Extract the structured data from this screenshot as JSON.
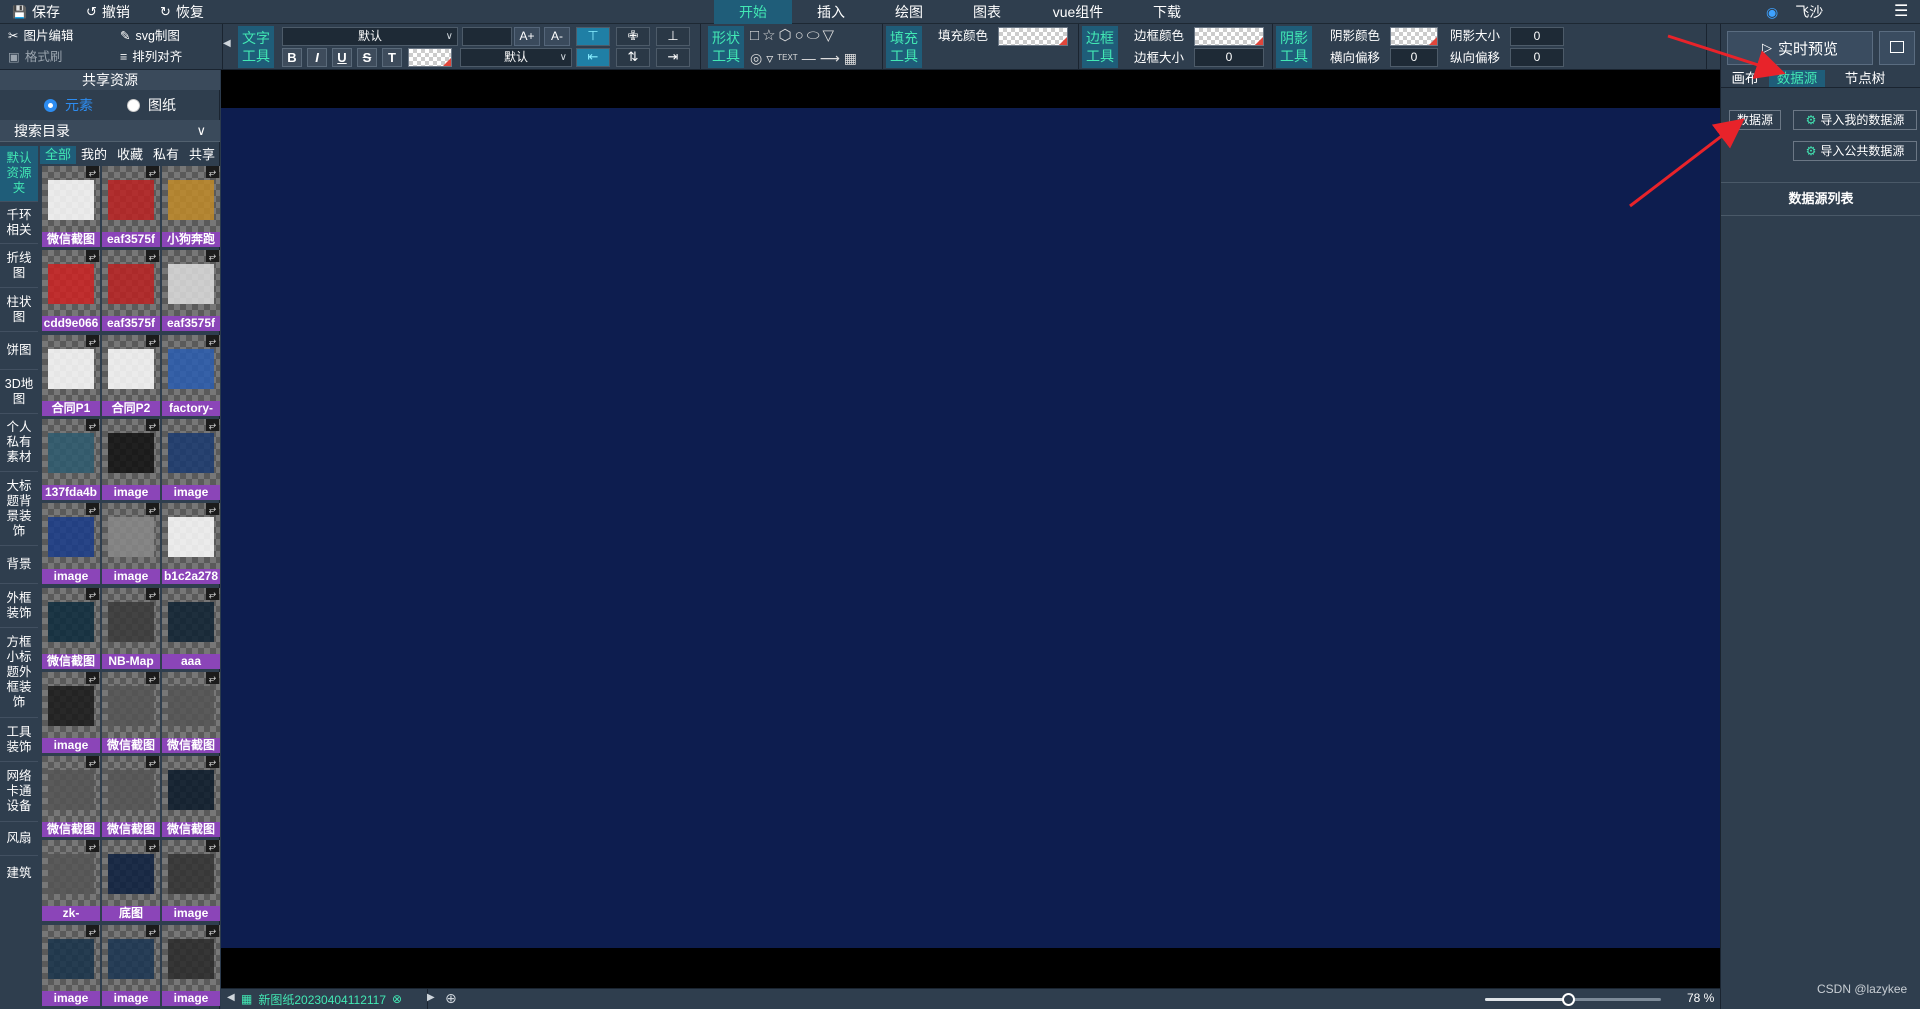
{
  "topbar": {
    "save": "保存",
    "undo": "撤销",
    "redo": "恢复",
    "tabs": [
      "开始",
      "插入",
      "绘图",
      "图表",
      "vue组件",
      "下载"
    ],
    "active_tab": 0,
    "user": "飞沙",
    "menu_icon": "hamburger-icon"
  },
  "toolbar": {
    "image_edit": "图片编辑",
    "svg_draw": "svg制图",
    "format_brush": "格式刷",
    "arrange_align": "排列对齐",
    "text_tool": "文字工具",
    "font_select": "默认",
    "size_select": "默认",
    "font_inc": "A+",
    "font_dec": "A-",
    "bold": "B",
    "italic": "I",
    "underline": "U",
    "strike": "S",
    "text_case": "T",
    "shape_tool": "形状工具",
    "shape_text": "TEXT",
    "fill_tool": "填充工具",
    "fill_color": "填充颜色",
    "border_tool": "边框工具",
    "border_color": "边框颜色",
    "border_size": "边框大小",
    "border_size_value": "0",
    "shadow_tool": "阴影工具",
    "shadow_color": "阴影颜色",
    "shadow_size": "阴影大小",
    "shadow_size_value": "0",
    "h_offset": "横向偏移",
    "h_offset_value": "0",
    "v_offset": "纵向偏移",
    "v_offset_value": "0"
  },
  "left_panel": {
    "title": "共享资源",
    "radio_element": "元素",
    "radio_drawing": "图纸",
    "search_dir": "搜索目录",
    "categories": [
      "默认资源夹",
      "千环相关",
      "折线图",
      "柱状图",
      "饼图",
      "3D地图",
      "个人私有素材",
      "大标题背景装饰",
      "背景",
      "外框装饰",
      "方框小标题外框装饰",
      "工具装饰",
      "网络卡通设备",
      "风扇",
      "建筑"
    ],
    "sub_tabs": [
      "全部",
      "我的",
      "收藏",
      "私有",
      "共享"
    ],
    "thumbs": [
      "微信截图",
      "eaf3575f",
      "小狗奔跑",
      "cdd9e066",
      "eaf3575f",
      "eaf3575f",
      "合同P1",
      "合同P2",
      "factory-",
      "137fda4b",
      "image",
      "image",
      "image",
      "image",
      "b1c2a278",
      "微信截图",
      "NB-Map",
      "aaa",
      "image",
      "微信截图",
      "微信截图",
      "微信截图",
      "微信截图",
      "微信截图",
      "zk-",
      "底图",
      "image",
      "image",
      "image",
      "image"
    ]
  },
  "bottom_bar": {
    "page_name": "新图纸20230404112117",
    "zoom": "78 %",
    "zoom_fraction": 0.47
  },
  "right_panel": {
    "preview": "实时预览",
    "tabs": [
      "画布",
      "数据源",
      "节点树"
    ],
    "active_tab": 1,
    "datasource_btn": "数据源",
    "import_mine": "导入我的数据源",
    "import_public": "导入公共数据源",
    "list_title": "数据源列表"
  },
  "watermark": "CSDN @lazykee",
  "colors": {
    "accent": "#42e8b4",
    "active_bg": "#1f5d79",
    "canvas": "#0d1d4f",
    "caption": "#8b45b8",
    "annotation_arrow": "#e8232a"
  }
}
